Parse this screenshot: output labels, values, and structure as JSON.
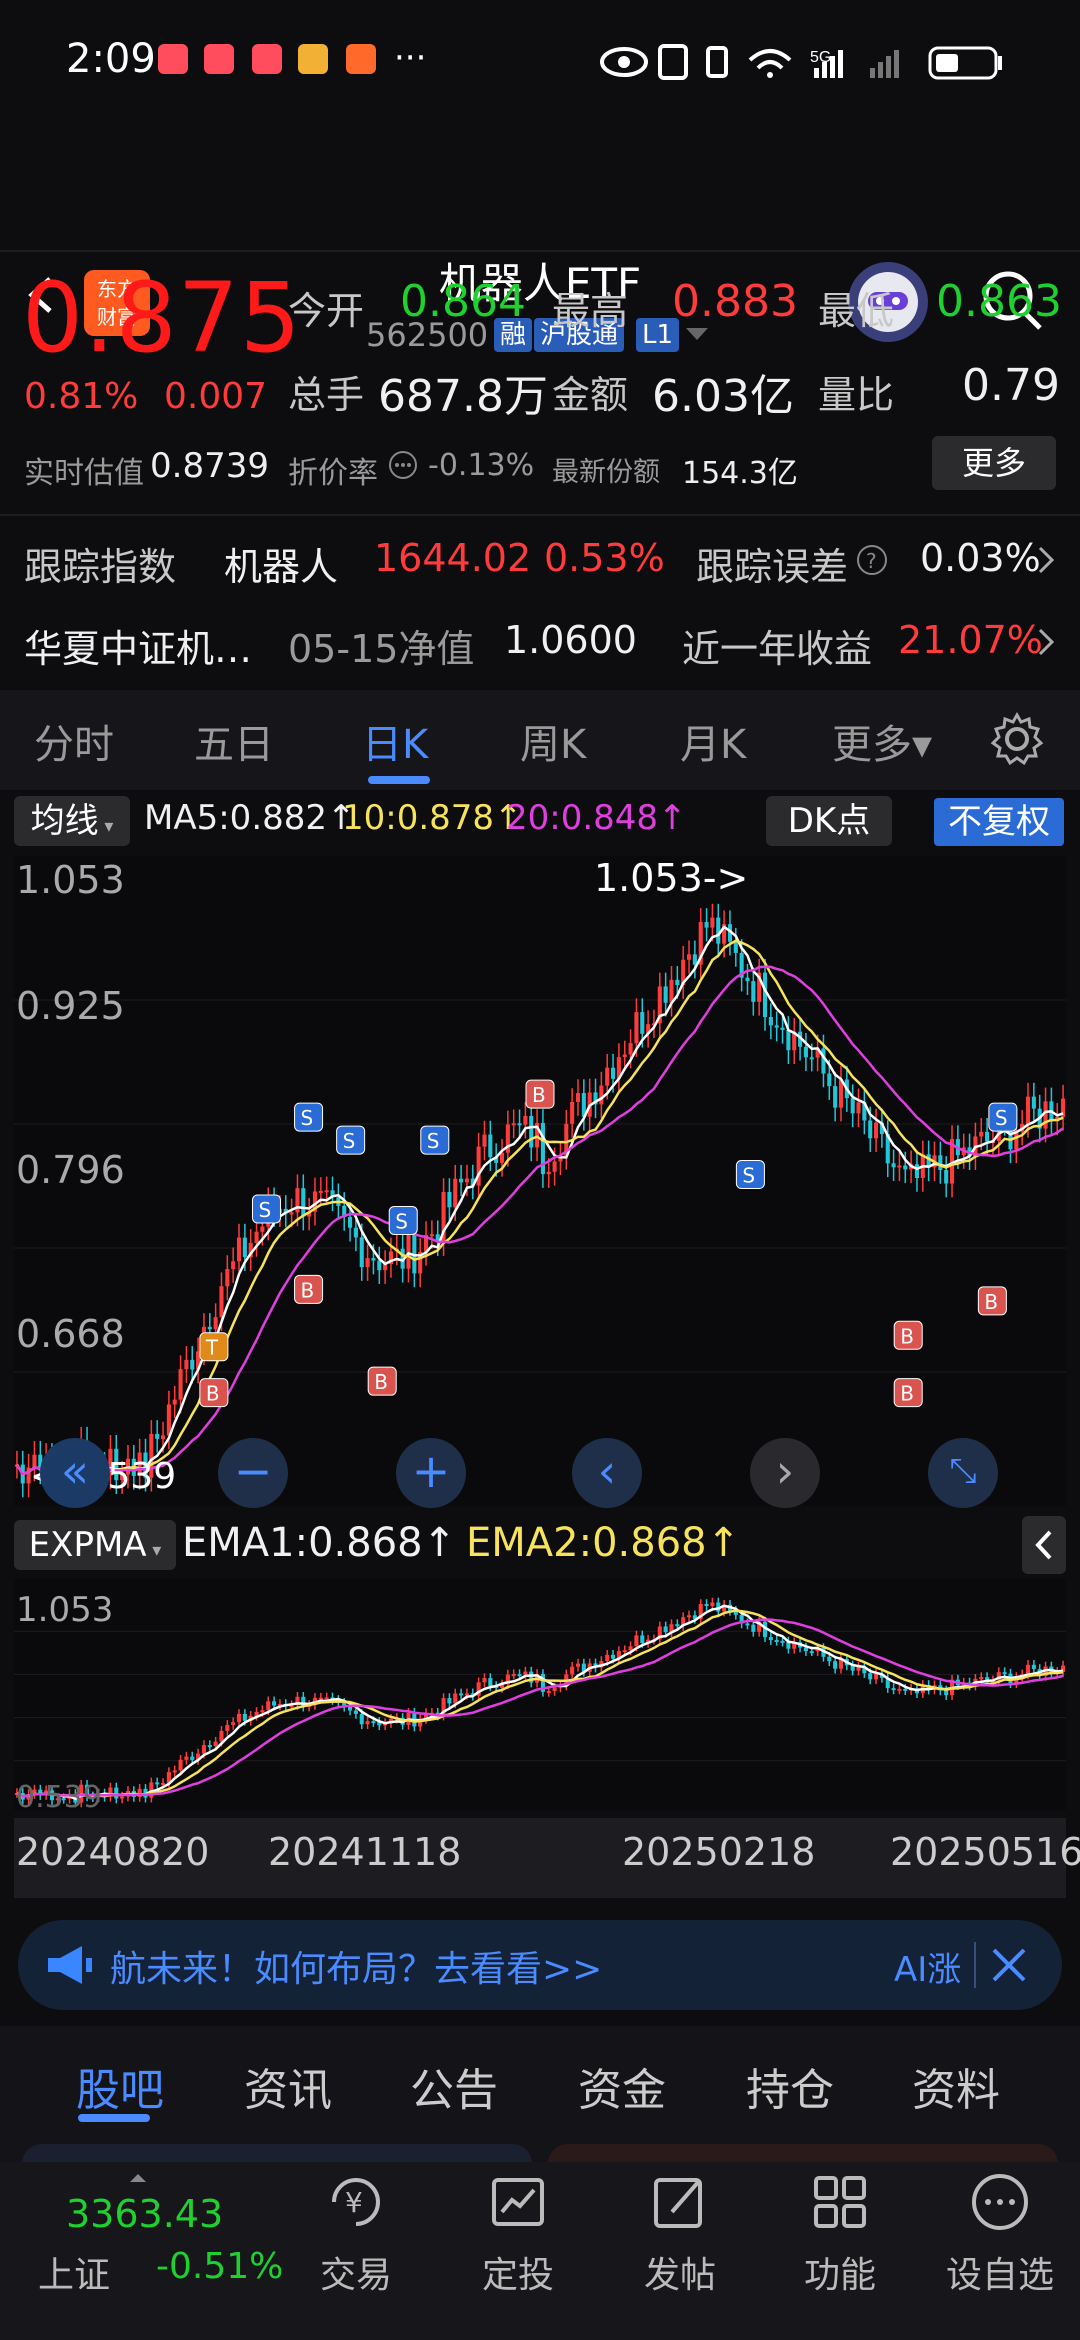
{
  "status_bar": {
    "time": "2:09",
    "more": "···",
    "network": "5G"
  },
  "header": {
    "logo_line1": "东方",
    "logo_line2": "财富",
    "title": "机器人ETF",
    "code": "562500",
    "tags": [
      "融",
      "沪股通",
      "L1"
    ]
  },
  "quote": {
    "price": "0.875",
    "change_pct": "0.81%",
    "change_abs": "0.007",
    "open_label": "今开",
    "open": "0.864",
    "high_label": "最高",
    "high": "0.883",
    "low_label": "最低",
    "low": "0.863",
    "volume_label": "总手",
    "volume": "687.8万",
    "amount_label": "金额",
    "amount": "6.03亿",
    "ratio_label": "量比",
    "ratio": "0.79",
    "est_label": "实时估值",
    "est": "0.8739",
    "discount_label": "折价率",
    "discount": "-0.13%",
    "shares_label": "最新份额",
    "shares": "154.3亿",
    "more_label": "更多"
  },
  "tracking": {
    "label": "跟踪指数",
    "index_name": "机器人",
    "index_value": "1644.02",
    "index_pct": "0.53%",
    "error_label": "跟踪误差",
    "error": "0.03%"
  },
  "fund": {
    "name": "华夏中证机…",
    "nav_label": "05-15净值",
    "nav": "1.0600",
    "year_label": "近一年收益",
    "year": "21.07%"
  },
  "k_tabs": [
    {
      "label": "分时"
    },
    {
      "label": "五日"
    },
    {
      "label": "日K"
    },
    {
      "label": "周K"
    },
    {
      "label": "月K"
    },
    {
      "label": "更多▾"
    }
  ],
  "indicator": {
    "ma_label": "均线",
    "ma5": "MA5:0.882↑",
    "ma10": "10:0.878↑",
    "ma20": "20:0.848↑",
    "dk": "DK点",
    "fq": "不复权"
  },
  "kchart": {
    "y_labels": [
      "1.053",
      "0.925",
      "0.796",
      "0.668"
    ],
    "max_note": "1.053->",
    "min_note": "<-0.539",
    "min_label": "0.539"
  },
  "ema": {
    "label": "EXPMA",
    "ema1": "EMA1:0.868↑",
    "ema2": "EMA2:0.868↑",
    "y_top": "1.053",
    "y_bottom": "0.539"
  },
  "dates": [
    "20240820",
    "20241118",
    "20250218",
    "20250516"
  ],
  "banner": {
    "text": "航未来！如何布局？去看看>>",
    "ai": "AI涨"
  },
  "bottom_tabs": [
    {
      "label": "股吧"
    },
    {
      "label": "资讯"
    },
    {
      "label": "公告"
    },
    {
      "label": "资金"
    },
    {
      "label": "持仓"
    },
    {
      "label": "资料"
    }
  ],
  "market": {
    "name": "上证",
    "value": "3363.43",
    "pct": "-0.51%"
  },
  "nav": [
    {
      "label": "交易"
    },
    {
      "label": "定投"
    },
    {
      "label": "发帖"
    },
    {
      "label": "功能"
    },
    {
      "label": "设自选"
    }
  ],
  "colors": {
    "up": "#ff3b3b",
    "down": "#1fd12f",
    "accent": "#4a8bff"
  }
}
